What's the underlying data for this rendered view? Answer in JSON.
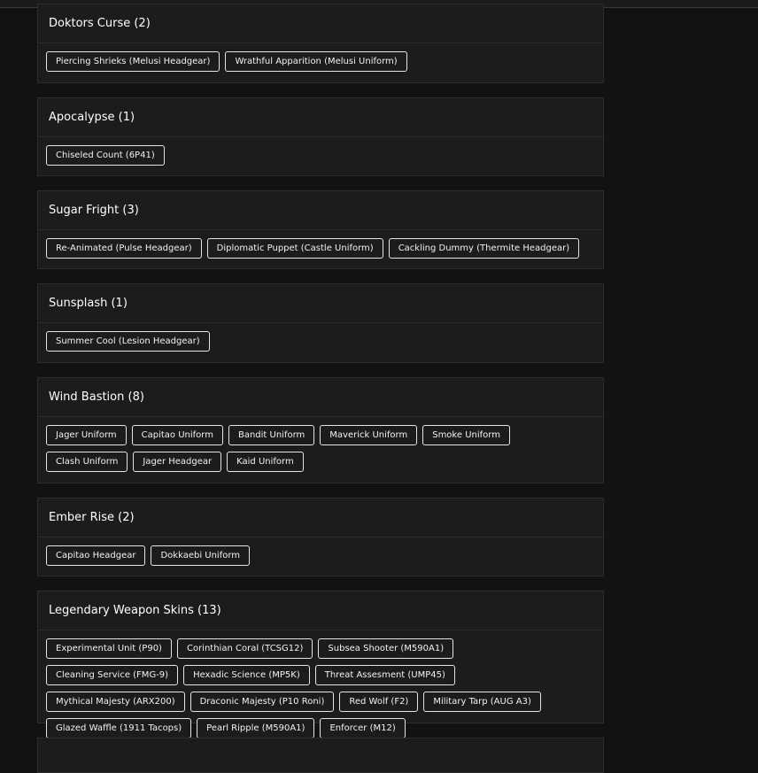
{
  "sections": [
    {
      "title": "Doktors Curse (2)",
      "items": [
        "Piercing Shrieks (Melusi Headgear)",
        "Wrathful Apparition (Melusi Uniform)"
      ]
    },
    {
      "title": "Apocalypse (1)",
      "items": [
        "Chiseled Count (6P41)"
      ]
    },
    {
      "title": "Sugar Fright (3)",
      "items": [
        "Re-Animated (Pulse Headgear)",
        "Diplomatic Puppet (Castle Uniform)",
        "Cackling Dummy (Thermite Headgear)"
      ]
    },
    {
      "title": "Sunsplash (1)",
      "items": [
        "Summer Cool (Lesion Headgear)"
      ]
    },
    {
      "title": "Wind Bastion (8)",
      "items": [
        "Jager Uniform",
        "Capitao Uniform",
        "Bandit Uniform",
        "Maverick Uniform",
        "Smoke Uniform",
        "Clash Uniform",
        "Jager Headgear",
        "Kaid Uniform"
      ]
    },
    {
      "title": "Ember Rise (2)",
      "items": [
        "Capitao Headgear",
        "Dokkaebi Uniform"
      ]
    },
    {
      "title": "Legendary Weapon Skins (13)",
      "items": [
        "Experimental Unit (P90)",
        "Corinthian Coral (TCSG12)",
        "Subsea Shooter (M590A1)",
        "Cleaning Service (FMG-9)",
        "Hexadic Science (MP5K)",
        "Threat Assesment (UMP45)",
        "Mythical Majesty (ARX200)",
        "Draconic Majesty (P10 Roni)",
        "Red Wolf (F2)",
        "Military Tarp (AUG A3)",
        "Glazed Waffle (1911 Tacops)",
        "Pearl Ripple (M590A1)",
        "Enforcer (M12)"
      ]
    }
  ],
  "colors": {
    "background": "#121212",
    "card": "#1c1c1c",
    "card_border": "#2c2c2c",
    "chip_border": "#e6e6e6",
    "text": "#ffffff"
  }
}
